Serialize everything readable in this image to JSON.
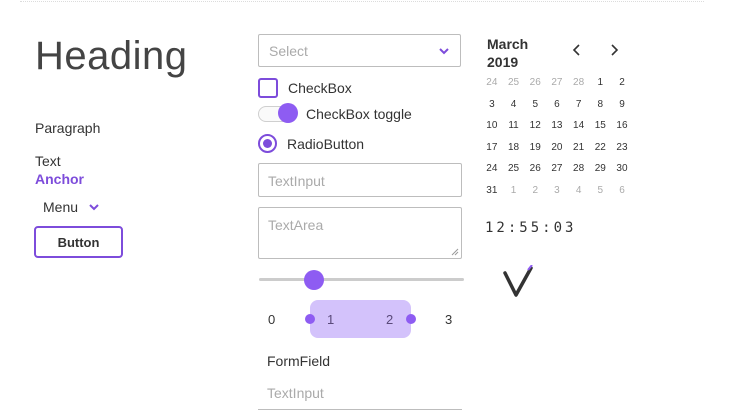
{
  "left": {
    "heading": "Heading",
    "paragraph": "Paragraph",
    "text": "Text",
    "anchor": "Anchor",
    "menu_label": "Menu",
    "button_label": "Button"
  },
  "middle": {
    "select_placeholder": "Select",
    "checkbox_label": "CheckBox",
    "toggle_label": "CheckBox toggle",
    "radio_label": "RadioButton",
    "textinput_placeholder": "TextInput",
    "textarea_placeholder": "TextArea",
    "slider_value_fraction": 0.27,
    "range": {
      "min_label": "0",
      "low_label": "1",
      "high_label": "2",
      "max_label": "3"
    },
    "formfield_label": "FormField",
    "formfield_placeholder": "TextInput"
  },
  "calendar": {
    "month": "March",
    "year": "2019",
    "weeks": [
      [
        {
          "d": "24",
          "m": true
        },
        {
          "d": "25",
          "m": true
        },
        {
          "d": "26",
          "m": true
        },
        {
          "d": "27",
          "m": true
        },
        {
          "d": "28",
          "m": true
        },
        {
          "d": "1"
        },
        {
          "d": "2"
        }
      ],
      [
        {
          "d": "3"
        },
        {
          "d": "4"
        },
        {
          "d": "5"
        },
        {
          "d": "6"
        },
        {
          "d": "7"
        },
        {
          "d": "8"
        },
        {
          "d": "9"
        }
      ],
      [
        {
          "d": "10"
        },
        {
          "d": "11"
        },
        {
          "d": "12"
        },
        {
          "d": "13"
        },
        {
          "d": "14"
        },
        {
          "d": "15"
        },
        {
          "d": "16"
        }
      ],
      [
        {
          "d": "17"
        },
        {
          "d": "18"
        },
        {
          "d": "19"
        },
        {
          "d": "20"
        },
        {
          "d": "21"
        },
        {
          "d": "22"
        },
        {
          "d": "23"
        }
      ],
      [
        {
          "d": "24"
        },
        {
          "d": "25"
        },
        {
          "d": "26"
        },
        {
          "d": "27"
        },
        {
          "d": "28"
        },
        {
          "d": "29"
        },
        {
          "d": "30"
        }
      ],
      [
        {
          "d": "31"
        },
        {
          "d": "1",
          "m": true
        },
        {
          "d": "2",
          "m": true
        },
        {
          "d": "3",
          "m": true
        },
        {
          "d": "4",
          "m": true
        },
        {
          "d": "5",
          "m": true
        },
        {
          "d": "6",
          "m": true
        }
      ]
    ],
    "clock": "12:55:03"
  },
  "colors": {
    "accent": "#7d4cdb",
    "knob": "#8e5cf2",
    "range_fill": "#d3c2fb",
    "placeholder": "#aaaaaa"
  },
  "icons": {
    "select": "chevron-down-icon",
    "menu": "chevron-down-icon",
    "calendar_prev": "chevron-left-icon",
    "calendar_next": "chevron-right-icon",
    "logo": "grommet-logo-icon"
  }
}
